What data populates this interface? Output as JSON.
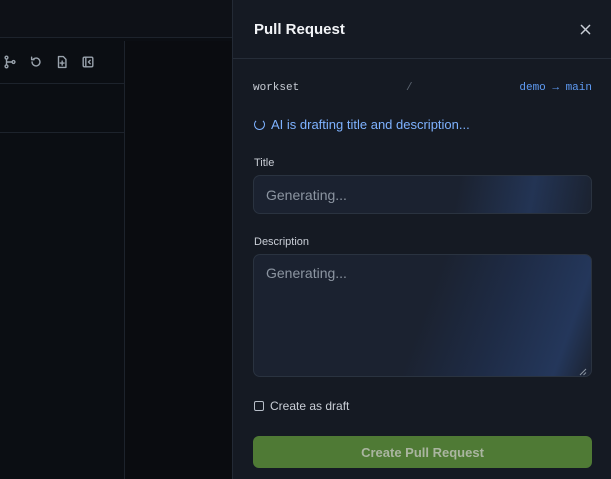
{
  "panel": {
    "title": "Pull Request",
    "repo": "workset",
    "separator": "/",
    "branch_info": "demo → main",
    "ai_status": "AI is drafting title and description...",
    "title_field": {
      "label": "Title",
      "placeholder": "Generating..."
    },
    "description_field": {
      "label": "Description",
      "placeholder": "Generating..."
    },
    "draft_label": "Create as draft",
    "submit_label": "Create Pull Request"
  },
  "toolbar_icons": [
    "git-branch-icon",
    "refresh-icon",
    "new-file-icon",
    "collapse-panel-icon"
  ],
  "colors": {
    "panel_bg": "#151a23",
    "accent_blue": "#5f9cf5",
    "submit_green": "#4f7a35"
  }
}
